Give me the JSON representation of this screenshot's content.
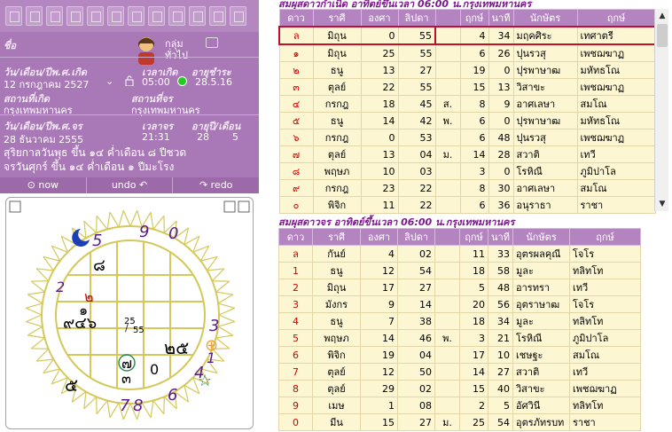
{
  "toolbar": {
    "icons": [
      "new-icon",
      "open-icon",
      "save-icon",
      "save-as-icon",
      "delete-icon",
      "print-icon",
      "tools-icon",
      "copy-icon",
      "paste-icon",
      "edit-icon",
      "check-icon",
      "chart-icon"
    ]
  },
  "profile": {
    "name_label": "ชื่อ",
    "group_label": "กลุ่ม",
    "group_value": "ทั่วไป",
    "birth_label": "วัน/เดือน/ปีพ.ศ.เกิด",
    "birth_time_label": "เวลาเกิด",
    "age_label": "อายุชำระ",
    "birth_date": "12 กรกฎาคม 2527",
    "birth_time": "05:00",
    "age_value": "28.5.16",
    "birthplace_label": "สถานที่เกิด",
    "residence_label": "สถานที่จร",
    "birthplace": "กรุงเทพมหานคร",
    "residence": "กรุงเทพมหานคร",
    "transit_label": "วัน/เดือน/ปีพ.ศ.จร",
    "transit_time_label": "เวลาจร",
    "age_ym_label": "อายุปี/เดือน",
    "transit_date": "28 ธันวาคม 2555",
    "transit_time": "21:31",
    "age_years": "28",
    "age_months": "5",
    "solar_line": "สุริยกาลวันพุธ ขึ้น ๑๔ ค่ำเดือน ๘ ปีชวด",
    "transit_line": "จรวันศุกร์ ขึ้น ๑๔ ค่ำเดือน ๑ ปีมะโรง"
  },
  "nav": {
    "now": "now",
    "undo": "undo",
    "redo": "redo"
  },
  "horoscope": {
    "center_label_top": "25",
    "center_label_bottom": "55",
    "house_texts": {
      "top": "๘",
      "upper_left": "๒",
      "upper_left_inner": "๑",
      "left": "๙๔๖",
      "right": "๒๕",
      "lower_left": "๗",
      "lower_left_b": "๓",
      "bottom": "0",
      "bottom_left_outer": "๕"
    },
    "outer_numbers": [
      "9",
      "0",
      "5",
      "2",
      "3",
      "1",
      "4",
      "6",
      "7",
      "8",
      "8",
      "3"
    ]
  },
  "natal_table": {
    "caption": "สมผุสดาวกำเนิด   อาทิตย์ขึ้นเวลา 06:00 น.กรุงเทพมหานคร",
    "headers": [
      "ดาว",
      "ราศี",
      "องศา",
      "ลิปดา",
      "",
      "ฤกษ์",
      "นาที",
      "นักษัตร",
      "ฤกษ์"
    ],
    "rows": [
      [
        "ล",
        "มิถุน",
        "0",
        "55",
        "",
        "4",
        "34",
        "มฤคศิระ",
        "เทศาตรี"
      ],
      [
        "๑",
        "มิถุน",
        "25",
        "55",
        "",
        "6",
        "26",
        "ปุนรวสุ",
        "เพชฌฆาฏ"
      ],
      [
        "๒",
        "ธนู",
        "13",
        "27",
        "",
        "19",
        "0",
        "ปุรพาษาฒ",
        "มหัทธโณ"
      ],
      [
        "๓",
        "ตุลย์",
        "22",
        "55",
        "",
        "15",
        "13",
        "วิสาขะ",
        "เพชฌฆาฏ"
      ],
      [
        "๔",
        "กรกฎ",
        "18",
        "45",
        "ส.",
        "8",
        "9",
        "อาศเลษา",
        "สมโณ"
      ],
      [
        "๕",
        "ธนู",
        "14",
        "42",
        "พ.",
        "6",
        "0",
        "ปุรพาษาฒ",
        "มหัทธโณ"
      ],
      [
        "๖",
        "กรกฎ",
        "0",
        "53",
        "",
        "6",
        "48",
        "ปุนรวสุ",
        "เพชฌฆาฏ"
      ],
      [
        "๗",
        "ตุลย์",
        "13",
        "04",
        "ม.",
        "14",
        "28",
        "สวาติ",
        "เทวี"
      ],
      [
        "๘",
        "พฤษภ",
        "10",
        "03",
        "",
        "3",
        "0",
        "โรหิณี",
        "ภูมิปาโล"
      ],
      [
        "๙",
        "กรกฎ",
        "23",
        "22",
        "",
        "8",
        "30",
        "อาศเลษา",
        "สมโณ"
      ],
      [
        "๐",
        "พิจิก",
        "11",
        "22",
        "",
        "6",
        "36",
        "อนุราธา",
        "ราชา"
      ]
    ]
  },
  "transit_table": {
    "caption": "สมผุสดาวจร     อาทิตย์ขึ้นเวลา 06:00 น.กรุงเทพมหานคร",
    "headers": [
      "ดาว",
      "ราศี",
      "องศา",
      "ลิปดา",
      "",
      "ฤกษ์",
      "นาที",
      "นักษัตร",
      "ฤกษ์"
    ],
    "rows": [
      [
        "ล",
        "กันย์",
        "4",
        "02",
        "",
        "11",
        "33",
        "อุตรผลคุณี",
        "โจโร"
      ],
      [
        "1",
        "ธนู",
        "12",
        "54",
        "",
        "18",
        "58",
        "มูละ",
        "ทลิทโท"
      ],
      [
        "2",
        "มิถุน",
        "17",
        "27",
        "",
        "5",
        "48",
        "อารทรา",
        "เทวี"
      ],
      [
        "3",
        "มังกร",
        "9",
        "14",
        "",
        "20",
        "56",
        "อุตราษาฒ",
        "โจโร"
      ],
      [
        "4",
        "ธนู",
        "7",
        "38",
        "",
        "18",
        "34",
        "มูละ",
        "ทลิทโท"
      ],
      [
        "5",
        "พฤษภ",
        "14",
        "46",
        "พ.",
        "3",
        "21",
        "โรหิณี",
        "ภูมิปาโล"
      ],
      [
        "6",
        "พิจิก",
        "19",
        "04",
        "",
        "17",
        "10",
        "เชษฐะ",
        "สมโณ"
      ],
      [
        "7",
        "ตุลย์",
        "12",
        "50",
        "",
        "14",
        "27",
        "สวาติ",
        "เทวี"
      ],
      [
        "8",
        "ตุลย์",
        "29",
        "02",
        "",
        "15",
        "40",
        "วิสาขะ",
        "เพชฌฆาฏ"
      ],
      [
        "9",
        "เมษ",
        "1",
        "08",
        "",
        "2",
        "5",
        "อัศวินี",
        "ทลิทโท"
      ],
      [
        "0",
        "มีน",
        "15",
        "27",
        "ม.",
        "25",
        "54",
        "อุตรภัทรบท",
        "ราชา"
      ]
    ]
  },
  "colors": {
    "accent": "#b484c0",
    "cell": "#fdf6d3",
    "select": "#c2102a",
    "red_text": "#d20000"
  }
}
